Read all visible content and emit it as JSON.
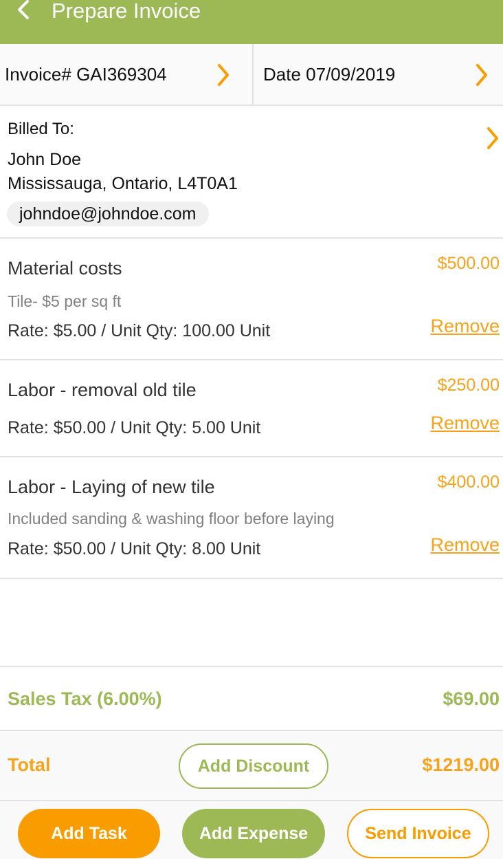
{
  "header": {
    "title": "Prepare Invoice",
    "back_icon": "chevron-left-icon",
    "color": "#9db956"
  },
  "invoice": {
    "number_label": "Invoice# GAI369304",
    "date_label": "Date 07/09/2019"
  },
  "billed_to": {
    "label": "Billed To:",
    "name": "John Doe",
    "address": "Mississauga, Ontario, L4T0A1",
    "email": "johndoe@johndoe.com"
  },
  "items": [
    {
      "name": "Material costs",
      "description": "Tile- $5 per sq ft",
      "rate_qty": "Rate: $5.00 / Unit  Qty: 100.00 Unit",
      "amount": "$500.00",
      "remove_label": "Remove"
    },
    {
      "name": "Labor - removal old tile",
      "description": "",
      "rate_qty": "Rate: $50.00 / Unit  Qty: 5.00 Unit",
      "amount": "$250.00",
      "remove_label": "Remove"
    },
    {
      "name": "Labor - Laying of new tile",
      "description": "Included sanding & washing floor before laying",
      "rate_qty": "Rate: $50.00 / Unit  Qty: 8.00 Unit",
      "amount": "$400.00",
      "remove_label": "Remove"
    }
  ],
  "tax": {
    "label": "Sales Tax (6.00%)",
    "value": "$69.00"
  },
  "total": {
    "label": "Total",
    "value": "$1219.00",
    "discount_button": "Add Discount"
  },
  "footer": {
    "add_task": "Add Task",
    "add_expense": "Add Expense",
    "send_invoice": "Send Invoice"
  },
  "colors": {
    "green": "#9db956",
    "orange": "#f99c00"
  }
}
